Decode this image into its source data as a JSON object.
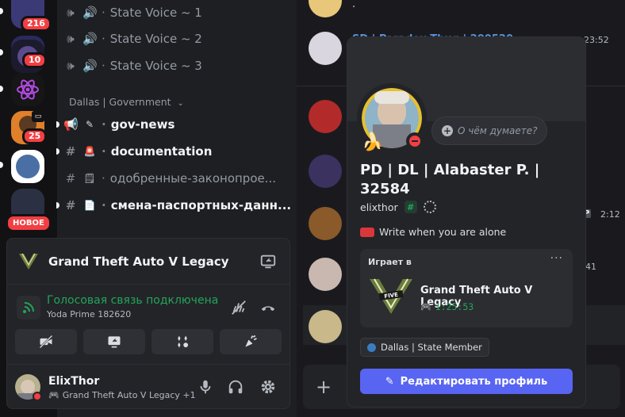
{
  "servers": {
    "badges": [
      "216",
      "10",
      "25"
    ],
    "new_label": "НОВОЕ"
  },
  "channels": {
    "voice": [
      "State Voice ~ 1",
      "State Voice ~ 2",
      "State Voice ~ 3"
    ],
    "category": "Dallas | Government",
    "text": [
      {
        "name": "gov-news",
        "bold": true
      },
      {
        "name": "documentation",
        "bold": true
      },
      {
        "name": "одобренные-законопрое...",
        "bold": false
      },
      {
        "name": "смена-паспортных-данн...",
        "bold": true
      }
    ]
  },
  "voice_panel": {
    "game_title": "Grand Theft Auto V Legacy",
    "connection_status": "Голосовая связь подключена",
    "connection_sub": "Yoda Prime 182620"
  },
  "current_user": {
    "name": "ElixThor",
    "activity": "Grand Theft Auto V Legacy +1"
  },
  "chat": {
    "top_text": "·",
    "msg_header": "SD | Paradox Thug | 200520",
    "msg_time": "23:52",
    "side_time": "2:12",
    "side_tag": "P",
    "side_num": "41"
  },
  "profile": {
    "display_name": "PD | DL | Alabaster P. | 32584",
    "username": "elixthor",
    "tag": "#",
    "custom_status": "Write when you are alone",
    "thought_bubble": "О чём думаете?",
    "activity_header": "Играет в",
    "activity_more": "···",
    "activity_game": "Grand Theft Auto V Legacy",
    "activity_time": "1:25:53",
    "role": "Dallas | State Member",
    "edit_button": "Редактировать профиль"
  },
  "colors": {
    "accent": "#5865f2",
    "online_green": "#23a55a",
    "dnd_red": "#f23f43",
    "role_blue": "#3a7cc2"
  }
}
